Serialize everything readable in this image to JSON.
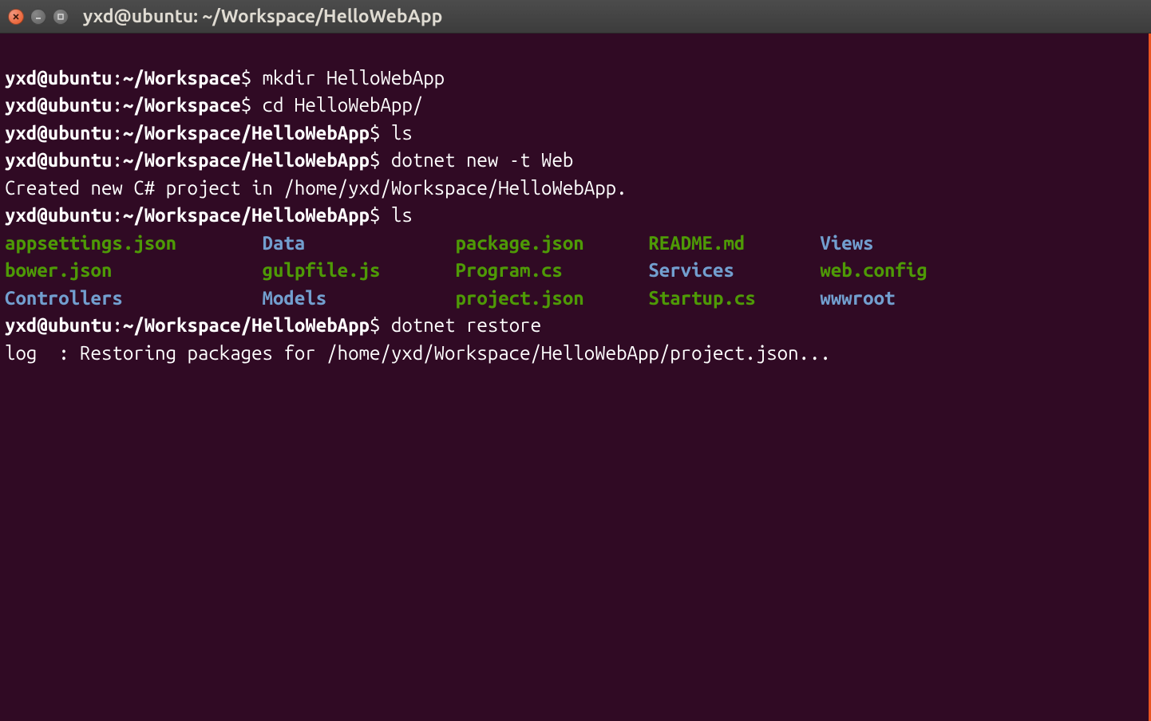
{
  "window": {
    "title": "yxd@ubuntu: ~/Workspace/HelloWebApp"
  },
  "prompts": {
    "p1": {
      "userhost": "yxd@ubuntu",
      "colon": ":",
      "path": "~/Workspace",
      "dollar": "$",
      "cmd": "mkdir HelloWebApp"
    },
    "p2": {
      "userhost": "yxd@ubuntu",
      "colon": ":",
      "path": "~/Workspace",
      "dollar": "$",
      "cmd": "cd HelloWebApp/"
    },
    "p3": {
      "userhost": "yxd@ubuntu",
      "colon": ":",
      "path": "~/Workspace/HelloWebApp",
      "dollar": "$",
      "cmd": "ls"
    },
    "p4": {
      "userhost": "yxd@ubuntu",
      "colon": ":",
      "path": "~/Workspace/HelloWebApp",
      "dollar": "$",
      "cmd": "dotnet new -t Web"
    },
    "p5": {
      "userhost": "yxd@ubuntu",
      "colon": ":",
      "path": "~/Workspace/HelloWebApp",
      "dollar": "$",
      "cmd": "ls"
    },
    "p6": {
      "userhost": "yxd@ubuntu",
      "colon": ":",
      "path": "~/Workspace/HelloWebApp",
      "dollar": "$",
      "cmd": "dotnet restore"
    }
  },
  "outputs": {
    "created": "Created new C# project in /home/yxd/Workspace/HelloWebApp.",
    "restore_log": "log  : Restoring packages for /home/yxd/Workspace/HelloWebApp/project.json..."
  },
  "ls": {
    "r1c1": "appsettings.json",
    "r1c2": "Data",
    "r1c3": "package.json",
    "r1c4": "README.md",
    "r1c5": "Views",
    "r2c1": "bower.json",
    "r2c2": "gulpfile.js",
    "r2c3": "Program.cs",
    "r2c4": "Services",
    "r2c5": "web.config",
    "r3c1": "Controllers",
    "r3c2": "Models",
    "r3c3": "project.json",
    "r3c4": "Startup.cs",
    "r3c5": "wwwroot"
  }
}
